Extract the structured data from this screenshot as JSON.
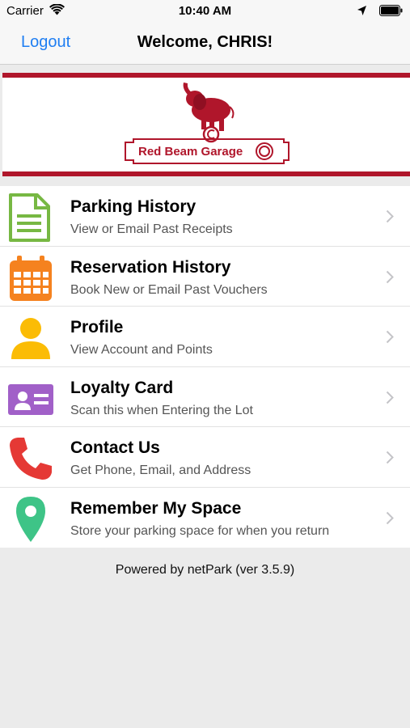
{
  "status_bar": {
    "carrier": "Carrier",
    "time": "10:40 AM"
  },
  "nav": {
    "logout_label": "Logout",
    "title": "Welcome, CHRIS!"
  },
  "banner": {
    "logo_text": "Red Beam Garage",
    "brand_color": "#b0162b"
  },
  "menu": {
    "items": [
      {
        "title": "Parking History",
        "subtitle": "View or Email Past Receipts",
        "icon": "document-icon",
        "color": "#77b843"
      },
      {
        "title": "Reservation History",
        "subtitle": "Book New or Email Past Vouchers",
        "icon": "calendar-icon",
        "color": "#f5821f"
      },
      {
        "title": "Profile",
        "subtitle": "View Account and Points",
        "icon": "user-icon",
        "color": "#fbbc05"
      },
      {
        "title": "Loyalty Card",
        "subtitle": "Scan this when Entering the Lot",
        "icon": "id-card-icon",
        "color": "#a160c8"
      },
      {
        "title": "Contact Us",
        "subtitle": "Get Phone, Email, and Address",
        "icon": "phone-icon",
        "color": "#e53935"
      },
      {
        "title": "Remember My Space",
        "subtitle": "Store your parking space for when you return",
        "icon": "map-pin-icon",
        "color": "#3ec487"
      }
    ]
  },
  "footer": {
    "text": "Powered by netPark (ver 3.5.9)"
  }
}
